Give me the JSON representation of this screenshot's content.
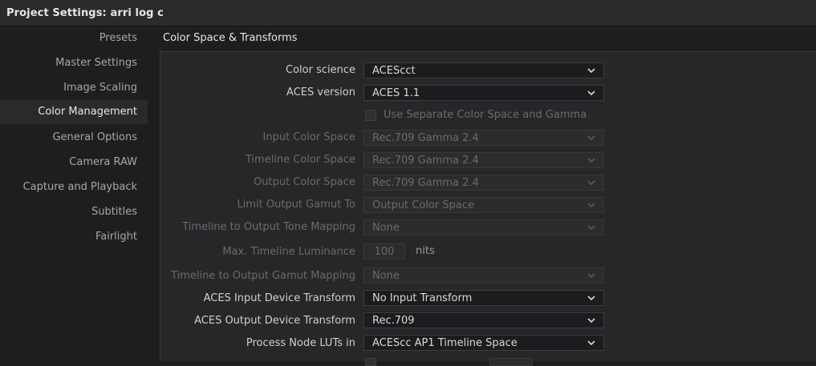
{
  "window": {
    "title": "Project Settings:  arri log c"
  },
  "sidebar": {
    "items": [
      {
        "label": "Presets"
      },
      {
        "label": "Master Settings"
      },
      {
        "label": "Image Scaling"
      },
      {
        "label": "Color Management",
        "active": true
      },
      {
        "label": "General Options"
      },
      {
        "label": "Camera RAW"
      },
      {
        "label": "Capture and Playback"
      },
      {
        "label": "Subtitles"
      },
      {
        "label": "Fairlight"
      }
    ]
  },
  "section": {
    "title": "Color Space & Transforms"
  },
  "settings": {
    "color_science": {
      "label": "Color science",
      "value": "ACEScct"
    },
    "aces_version": {
      "label": "ACES version",
      "value": "ACES 1.1"
    },
    "separate_color_space": {
      "label": "Use Separate Color Space and Gamma",
      "checked": false
    },
    "input_color_space": {
      "label": "Input Color Space",
      "value": "Rec.709 Gamma 2.4"
    },
    "timeline_color_space": {
      "label": "Timeline Color Space",
      "value": "Rec.709 Gamma 2.4"
    },
    "output_color_space": {
      "label": "Output Color Space",
      "value": "Rec.709 Gamma 2.4"
    },
    "limit_output_gamut": {
      "label": "Limit Output Gamut To",
      "value": "Output Color Space"
    },
    "tone_mapping": {
      "label": "Timeline to Output Tone Mapping",
      "value": "None"
    },
    "max_luminance": {
      "label": "Max. Timeline Luminance",
      "value": "100",
      "units": "nits"
    },
    "gamut_mapping": {
      "label": "Timeline to Output Gamut Mapping",
      "value": "None"
    },
    "aces_idt": {
      "label": "ACES Input Device Transform",
      "value": "No Input Transform"
    },
    "aces_odt": {
      "label": "ACES Output Device Transform",
      "value": "Rec.709"
    },
    "process_node_luts": {
      "label": "Process Node LUTs in",
      "value": "ACEScc AP1 Timeline Space"
    }
  },
  "colors": {
    "background": "#1e1e20",
    "panel": "#27272a",
    "active_item": "#2a2a2c",
    "text": "#e6e6e6",
    "text_dim": "#6b6b6e"
  }
}
